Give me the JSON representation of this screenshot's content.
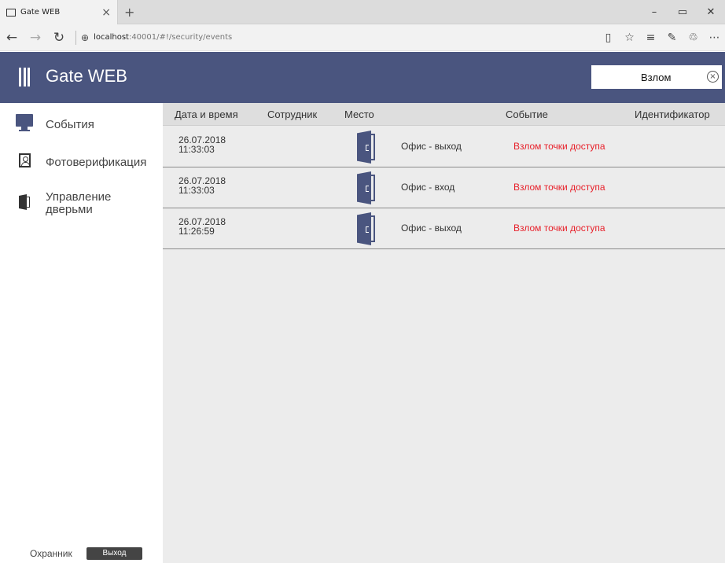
{
  "browser": {
    "tab_title": "Gate WEB",
    "tab_close": "×",
    "new_tab": "+",
    "url_host": "localhost",
    "url_rest": ":40001/#!/security/events",
    "win_min": "–",
    "win_max": "▭",
    "win_close": "✕"
  },
  "header": {
    "title": "Gate WEB",
    "search_value": "Взлом",
    "clear": "⊗"
  },
  "sidebar": {
    "items": [
      {
        "label": "События",
        "icon": "monitor-icon"
      },
      {
        "label": "Фотоверификация",
        "icon": "photo-id-icon"
      },
      {
        "label_line1": "Управление",
        "label_line2": "дверьми",
        "icon": "door-icon"
      }
    ],
    "user": "Охранник",
    "logout": "Выход"
  },
  "table": {
    "columns": [
      "Дата и время",
      "Сотрудник",
      "Место",
      "Событие",
      "Идентификатор"
    ],
    "rows": [
      {
        "date": "26.07.2018",
        "time": "11:33:03",
        "place": "Офис - выход",
        "event": "Взлом точки доступа"
      },
      {
        "date": "26.07.2018",
        "time": "11:33:03",
        "place": "Офис - вход",
        "event": "Взлом точки доступа"
      },
      {
        "date": "26.07.2018",
        "time": "11:26:59",
        "place": "Офис - выход",
        "event": "Взлом точки доступа"
      }
    ]
  },
  "colors": {
    "accent": "#4a557f",
    "event_text": "#e8202a",
    "content_bg": "#ececec"
  }
}
